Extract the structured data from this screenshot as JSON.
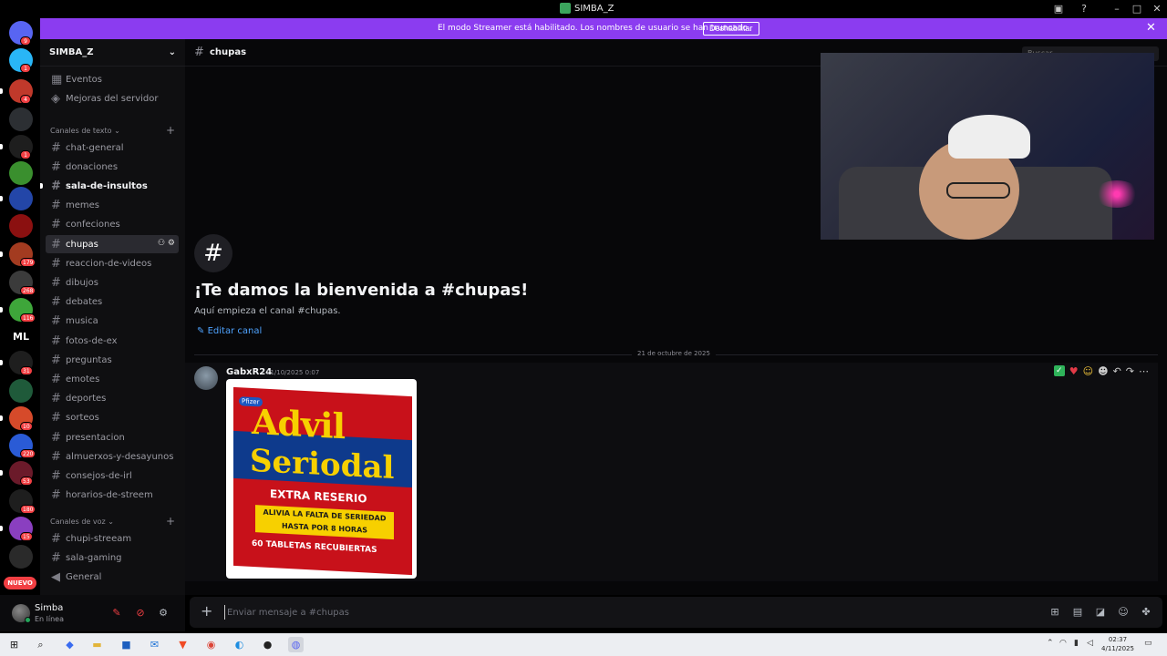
{
  "app": {
    "title": "SIMBA_Z"
  },
  "banner": {
    "message": "El modo Streamer está habilitado. Los nombres de usuario se han truncado.",
    "button_label": "Deshabilitar",
    "close_glyph": "✕"
  },
  "rail": {
    "servers": [
      {
        "badge": "9",
        "color": "#5865f2"
      },
      {
        "badge": "1",
        "color": "#29b6f6"
      },
      {
        "badge": "4",
        "color": "#c0392b"
      },
      {
        "badge": "",
        "color": "#2c2f33"
      },
      {
        "badge": "1",
        "color": "#1e1e1e"
      },
      {
        "badge": "",
        "color": "#3a8f2e"
      },
      {
        "badge": "",
        "color": "#2346a8"
      },
      {
        "badge": "",
        "color": "#8b1010"
      },
      {
        "badge": "179",
        "color": "#a33b20"
      },
      {
        "badge": "268",
        "color": "#3b3b3b"
      },
      {
        "badge": "116",
        "color": "#3ea63a"
      },
      {
        "badge": "",
        "color": "#1f1f1f"
      },
      {
        "badge": "31",
        "color": "#1e1e1e"
      },
      {
        "badge": "",
        "color": "#1f5a3a"
      },
      {
        "badge": "10",
        "color": "#d64a2a"
      },
      {
        "badge": "220",
        "color": "#2a5bd6"
      },
      {
        "badge": "53",
        "color": "#6b1a2a"
      },
      {
        "badge": "180",
        "color": "#1e1e1e"
      },
      {
        "badge": "15",
        "color": "#8a3fc0"
      },
      {
        "badge": "",
        "color": "#2a2a2a"
      }
    ],
    "ml_label": "ML",
    "new_label": "NUEVO"
  },
  "sidebar": {
    "server_name": "SIMBA_Z",
    "top_items": [
      "Eventos",
      "Mejoras del servidor"
    ],
    "text_category": "Canales de texto",
    "text_channels": [
      "chat-general",
      "donaciones",
      "sala-de-insultos",
      "memes",
      "confeciones",
      "chupas",
      "reaccion-de-videos",
      "dibujos",
      "debates",
      "musica",
      "fotos-de-ex",
      "preguntas",
      "emotes",
      "deportes",
      "sorteos",
      "presentacion",
      "almuerxos-y-desayunos",
      "consejos-de-irl",
      "horarios-de-streem"
    ],
    "voice_category": "Canales de voz",
    "voice_channels": [
      "chupi-streeam",
      "sala-gaming",
      "General"
    ]
  },
  "user": {
    "name": "Simba",
    "status": "En línea"
  },
  "channel": {
    "name": "chupas",
    "search_placeholder": "Buscar",
    "welcome_title": "¡Te damos la bienvenida a #chupas!",
    "welcome_sub": "Aquí empieza el canal #chupas.",
    "edit_label": "Editar canal",
    "date_divider": "21 de octubre de 2025"
  },
  "message": {
    "author": "GabxR24",
    "timestamp": "21/10/2025 0:07",
    "image": {
      "maker": "Pfizer",
      "brand": "Advil",
      "product": "Seriodal",
      "line1": "EXTRA RESERIO",
      "callout_1": "ALIVIA LA FALTA DE SERIEDAD",
      "callout_2": "HASTA POR  8 HORAS",
      "line3": "60 TABLETAS RECUBIERTAS"
    }
  },
  "composer": {
    "placeholder": "Enviar mensaje a #chupas"
  },
  "taskbar": {
    "time": "02:37",
    "date": "4/11/2025"
  },
  "colors": {
    "accent": "#8b3cf0",
    "link": "#4fa3ff",
    "online": "#23a55a",
    "badge": "#f23f43"
  }
}
